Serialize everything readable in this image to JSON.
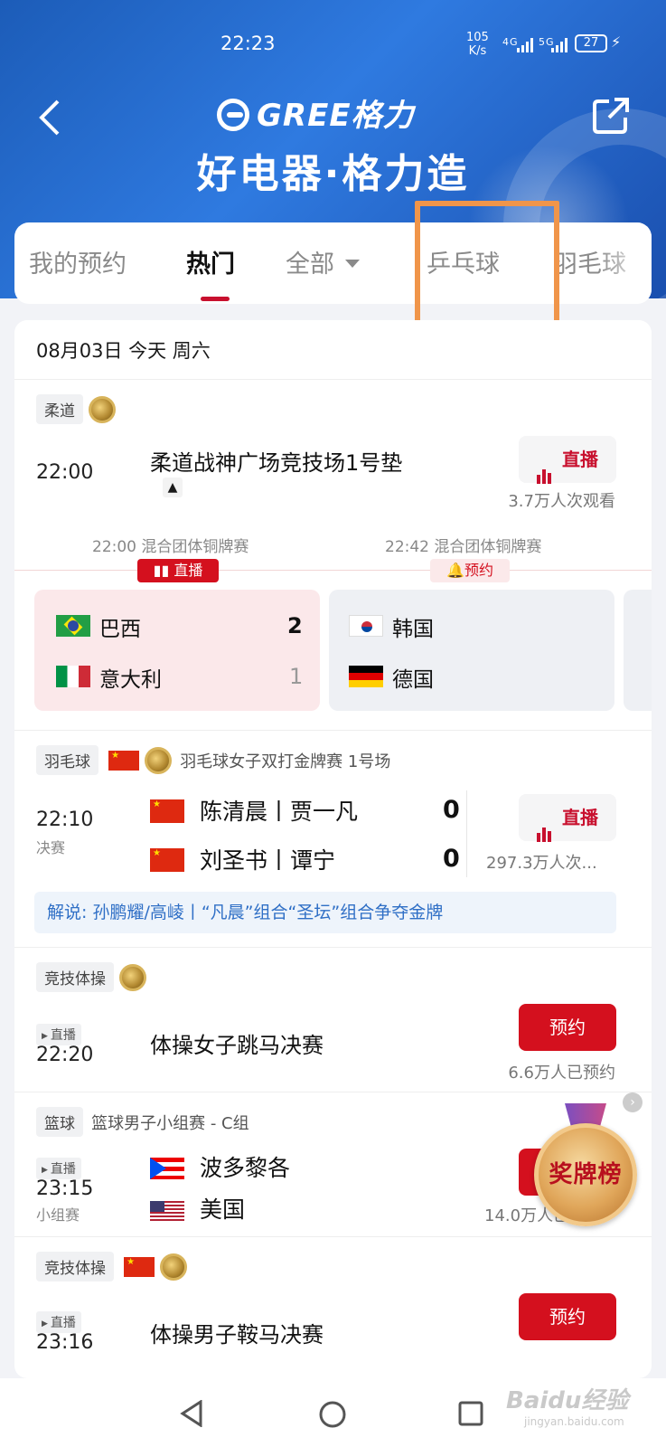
{
  "status_bar": {
    "time": "22:23",
    "speed_value": "105",
    "speed_unit": "K/s",
    "sig1": "4G",
    "sig2": "5G",
    "battery": "27"
  },
  "header": {
    "brand": "GREE格力",
    "slogan": "好电器·格力造"
  },
  "tabs": [
    {
      "label": "我的预约"
    },
    {
      "label": "热门"
    },
    {
      "label": "全部"
    },
    {
      "label": "乒乓球"
    },
    {
      "label": "羽毛球"
    }
  ],
  "date_header": "08月03日 今天 周六",
  "judo": {
    "category": "柔道",
    "time": "22:00",
    "venue": "柔道战神广场竞技场1号垫",
    "live_label": "直播",
    "viewers": "3.7万人次观看",
    "sub1_time": "22:00 混合团体铜牌赛",
    "sub1_status": "直播",
    "sub2_time": "22:42 混合团体铜牌赛",
    "sub2_status": "预约",
    "match1": {
      "team1": "巴西",
      "score1": "2",
      "team2": "意大利",
      "score2": "1"
    },
    "match2": {
      "team1": "韩国",
      "team2": "德国"
    }
  },
  "badminton": {
    "category": "羽毛球",
    "event": "羽毛球女子双打金牌赛 1号场",
    "time": "22:10",
    "stage": "决赛",
    "team1": "陈清晨丨贾一凡",
    "score1": "0",
    "team2": "刘圣书丨谭宁",
    "score2": "0",
    "live_label": "直播",
    "viewers": "297.3万人次...",
    "commentary": "解说: 孙鹏耀/高崚丨“凡晨”组合“圣坛”组合争夺金牌"
  },
  "gym1": {
    "category": "竞技体操",
    "tag": "直播",
    "time": "22:20",
    "title": "体操女子跳马决赛",
    "button": "预约",
    "reserved": "6.6万人已预约"
  },
  "basketball": {
    "category": "篮球",
    "event": "篮球男子小组赛 - C组",
    "tag": "直播",
    "time": "23:15",
    "stage": "小组赛",
    "team1": "波多黎各",
    "team2": "美国",
    "reserved": "14.0万人已预..."
  },
  "gym2": {
    "category": "竞技体操",
    "tag": "直播",
    "time": "23:16",
    "title": "体操男子鞍马决赛",
    "button": "预约"
  },
  "medal_board": "奖牌榜",
  "watermark": {
    "main": "Baidu经验",
    "sub": "jingyan.baidu.com"
  }
}
